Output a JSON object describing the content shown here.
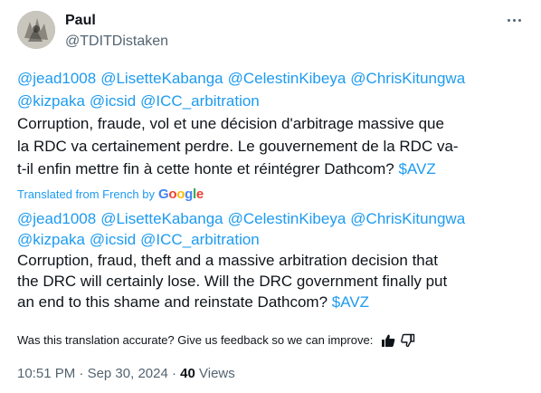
{
  "author": {
    "name": "Paul",
    "handle": "@TDITDistaken"
  },
  "original": {
    "mentions": [
      "@jead1008",
      "@LisetteKabanga",
      "@CelestinKibeya",
      "@ChrisKitungwa",
      "@kizpaka",
      "@icsid",
      "@ICC_arbitration"
    ],
    "line1": "Corruption, fraude, vol et une décision d'arbitrage massive que",
    "line2": "la RDC va certainement perdre.  Le gouvernement de la RDC va-",
    "line3": "t-il enfin mettre fin à cette honte et réintégrer Dathcom?",
    "cashtag": "$AVZ"
  },
  "translation_label": "Translated from French by",
  "translation_provider": "Google",
  "translated": {
    "mentions": [
      "@jead1008",
      "@LisetteKabanga",
      "@CelestinKibeya",
      "@ChrisKitungwa",
      "@kizpaka",
      "@icsid",
      "@ICC_arbitration"
    ],
    "line1": "Corruption, fraud, theft and a massive arbitration decision that",
    "line2": "the DRC will certainly lose. Will the DRC government finally put",
    "line3": "an end to this shame and reinstate Dathcom?",
    "cashtag": "$AVZ"
  },
  "feedback": {
    "question": "Was this translation accurate? Give us feedback so we can improve:",
    "icons": [
      "thumbs-up-icon",
      "thumbs-down-icon"
    ]
  },
  "meta": {
    "time": "10:51 PM",
    "separator": "·",
    "date": "Sep 30, 2024",
    "views_count": "40",
    "views_label": "Views"
  },
  "colors": {
    "link": "#1d9bf0",
    "text": "#0f1419",
    "secondary": "#536471"
  }
}
